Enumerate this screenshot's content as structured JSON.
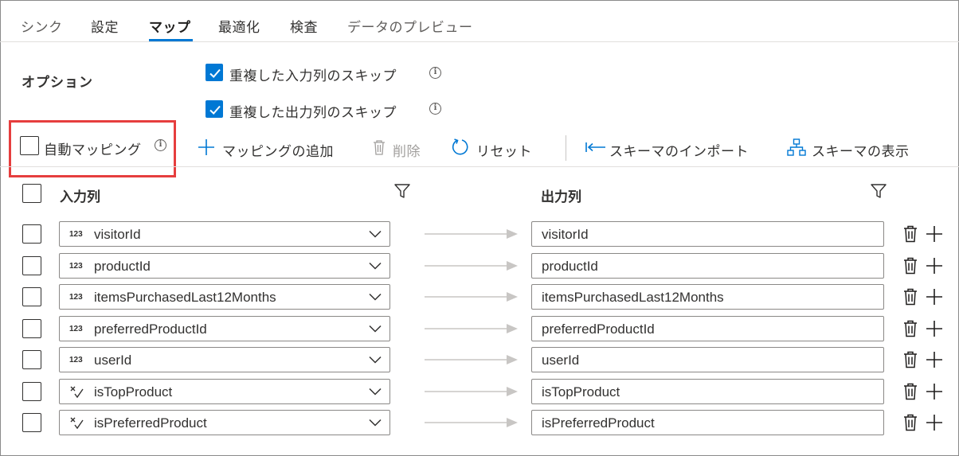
{
  "tabs": [
    {
      "label": "シンク"
    },
    {
      "label": "設定"
    },
    {
      "label": "マップ"
    },
    {
      "label": "最適化"
    },
    {
      "label": "検査"
    },
    {
      "label": "データのプレビュー"
    }
  ],
  "active_tab": "マップ",
  "options": {
    "title": "オプション",
    "skip_duplicate_input": {
      "label": "重複した入力列のスキップ",
      "checked": true
    },
    "skip_duplicate_output": {
      "label": "重複した出力列のスキップ",
      "checked": true
    }
  },
  "toolbar": {
    "auto_mapping": {
      "label": "自動マッピング",
      "checked": false
    },
    "add_mapping": "マッピングの追加",
    "delete": "削除",
    "reset": "リセット",
    "import_schema": "スキーマのインポート",
    "show_schema": "スキーマの表示"
  },
  "columns": {
    "input": "入力列",
    "output": "出力列"
  },
  "type_labels": {
    "integer": "123"
  },
  "accent_color": "#0078d4",
  "highlight_color": "#e63e3e",
  "mappings": [
    {
      "input": "visitorId",
      "output": "visitorId",
      "type": "integer"
    },
    {
      "input": "productId",
      "output": "productId",
      "type": "integer"
    },
    {
      "input": "itemsPurchasedLast12Months",
      "output": "itemsPurchasedLast12Months",
      "type": "integer"
    },
    {
      "input": "preferredProductId",
      "output": "preferredProductId",
      "type": "integer"
    },
    {
      "input": "userId",
      "output": "userId",
      "type": "integer"
    },
    {
      "input": "isTopProduct",
      "output": "isTopProduct",
      "type": "boolean"
    },
    {
      "input": "isPreferredProduct",
      "output": "isPreferredProduct",
      "type": "boolean"
    }
  ]
}
